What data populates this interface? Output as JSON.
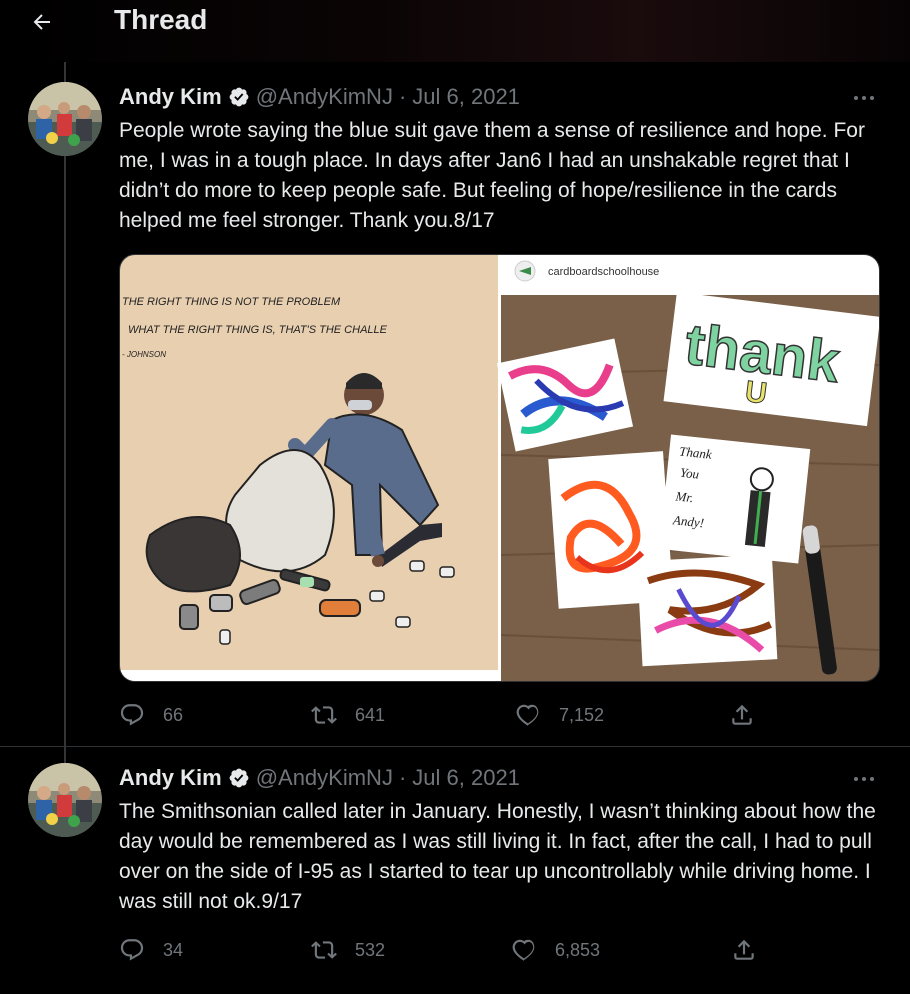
{
  "header": {
    "title": "Thread"
  },
  "tweets": [
    {
      "name": "Andy Kim",
      "handle": "@AndyKimNJ",
      "separator": "·",
      "date": "Jul 6, 2021",
      "text": "People wrote saying the blue suit gave them a sense of resilience and hope. For me, I was in a tough place. In days after Jan6 I had an unshakable regret that I didn’t do more to keep people safe. But feeling of hope/resilience in the cards helped me feel stronger. Thank you.8/17",
      "media": {
        "left_caption_lines": [
          "THE RIGHT THING IS NOT THE PROBLEM",
          "WHAT THE RIGHT THING IS, THAT'S THE CHALLE",
          "- JOHNSON"
        ],
        "right_account": "cardboardschoolhouse",
        "card_thank": "thank",
        "card_u": "U",
        "card_note_lines": [
          "Thank",
          "You",
          "Mr.",
          "Andy!"
        ]
      },
      "stats": {
        "replies": "66",
        "retweets": "641",
        "likes": "7,152"
      }
    },
    {
      "name": "Andy Kim",
      "handle": "@AndyKimNJ",
      "separator": "·",
      "date": "Jul 6, 2021",
      "text": "The Smithsonian called later in January. Honestly, I wasn’t thinking about how the day would be remembered as I was still living it. In fact, after the call, I had to pull over on the side of I-95 as I started to tear up uncontrollably while driving home. I was still not ok.9/17",
      "stats": {
        "replies": "34",
        "retweets": "532",
        "likes": "6,853"
      }
    }
  ],
  "icons": {
    "back": "arrow-left-icon",
    "verified": "verified-badge-icon",
    "more": "more-dots-icon",
    "reply": "reply-icon",
    "retweet": "retweet-icon",
    "like": "heart-icon",
    "share": "share-icon"
  },
  "colors": {
    "background": "#000000",
    "text": "#e7e9ea",
    "secondary": "#71767b",
    "border": "#2f3336",
    "verified": "#e7e9ea"
  }
}
